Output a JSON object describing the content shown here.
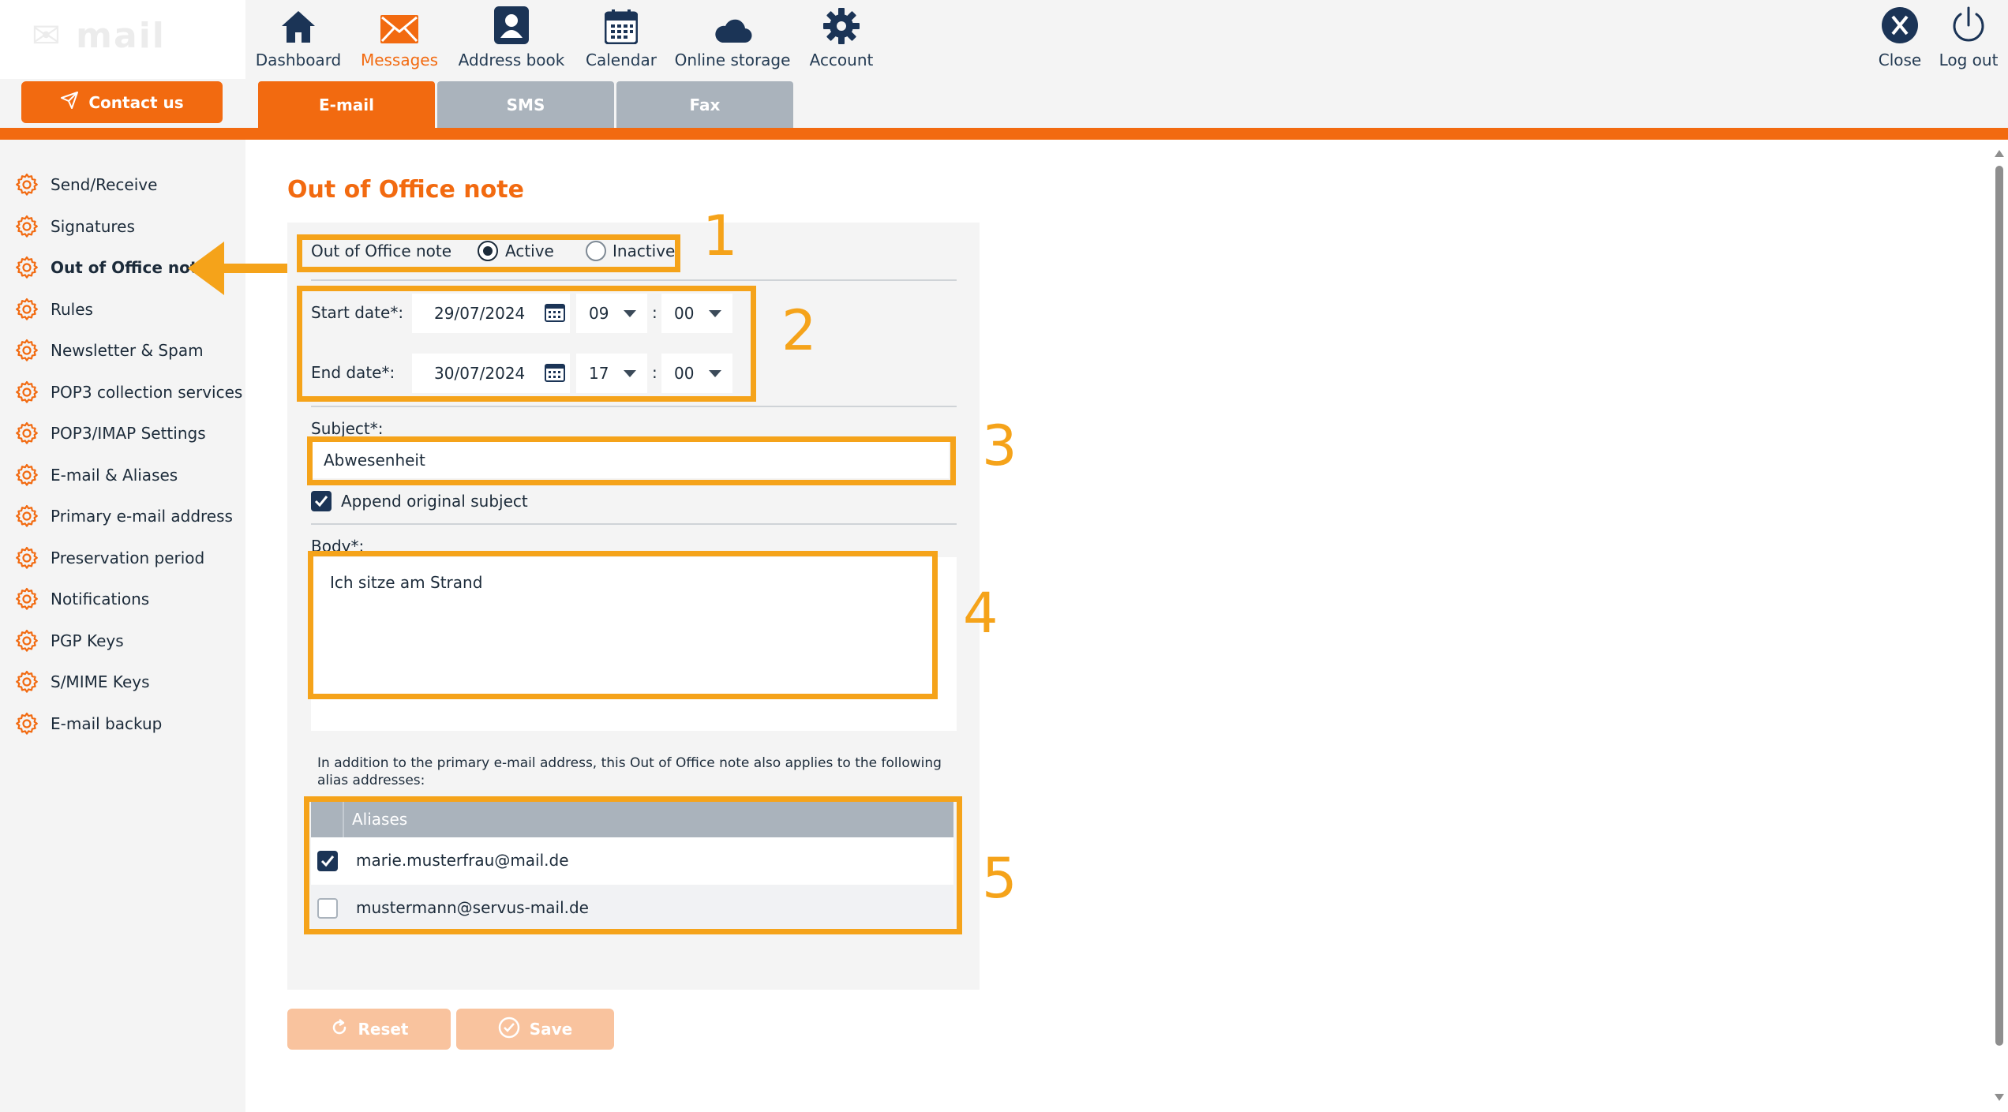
{
  "header": {
    "contact_label": "Contact us",
    "nav": [
      {
        "label": "Dashboard",
        "icon": "home-icon"
      },
      {
        "label": "Messages",
        "icon": "envelope-icon"
      },
      {
        "label": "Address book",
        "icon": "contact-card-icon"
      },
      {
        "label": "Calendar",
        "icon": "calendar-icon"
      },
      {
        "label": "Online storage",
        "icon": "cloud-icon"
      },
      {
        "label": "Account",
        "icon": "gear-icon"
      }
    ],
    "right_nav": [
      {
        "label": "Close",
        "icon": "close-icon"
      },
      {
        "label": "Log out",
        "icon": "power-icon"
      }
    ],
    "tabs": [
      {
        "label": "E-mail",
        "active": true
      },
      {
        "label": "SMS",
        "active": false
      },
      {
        "label": "Fax",
        "active": false
      }
    ]
  },
  "sidebar": {
    "items": [
      {
        "label": "Send/Receive"
      },
      {
        "label": "Signatures"
      },
      {
        "label": "Out of Office note",
        "active": true
      },
      {
        "label": "Rules"
      },
      {
        "label": "Newsletter & Spam"
      },
      {
        "label": "POP3 collection services"
      },
      {
        "label": "POP3/IMAP Settings"
      },
      {
        "label": "E-mail & Aliases"
      },
      {
        "label": "Primary e-mail address"
      },
      {
        "label": "Preservation period"
      },
      {
        "label": "Notifications"
      },
      {
        "label": "PGP Keys"
      },
      {
        "label": "S/MIME Keys"
      },
      {
        "label": "E-mail backup"
      }
    ]
  },
  "main": {
    "title": "Out of Office note",
    "status": {
      "label": "Out of Office note",
      "options": [
        "Active",
        "Inactive"
      ],
      "selected": "Active"
    },
    "start": {
      "label": "Start date*:",
      "date": "29/07/2024",
      "hour": "09",
      "minute": "00"
    },
    "end": {
      "label": "End date*:",
      "date": "30/07/2024",
      "hour": "17",
      "minute": "00"
    },
    "time_separator": ":",
    "subject": {
      "label": "Subject*:",
      "value": "Abwesenheit"
    },
    "append_subject": {
      "label": "Append original subject",
      "checked": true
    },
    "body": {
      "label": "Body*:",
      "value": "Ich sitze am Strand"
    },
    "alias_note": "In addition to the primary e-mail address, this Out of Office note also applies to the following alias addresses:",
    "aliases": {
      "header": "Aliases",
      "rows": [
        {
          "address": "marie.musterfrau@mail.de",
          "checked": true
        },
        {
          "address": "mustermann@servus-mail.de",
          "checked": false
        }
      ]
    },
    "buttons": {
      "reset": "Reset",
      "save": "Save"
    }
  },
  "annotations": [
    "1",
    "2",
    "3",
    "4",
    "5"
  ],
  "colors": {
    "accent": "#f26a10",
    "annotation": "#f5a31a",
    "navy": "#1b3456",
    "tab_inactive": "#aab3bc"
  }
}
